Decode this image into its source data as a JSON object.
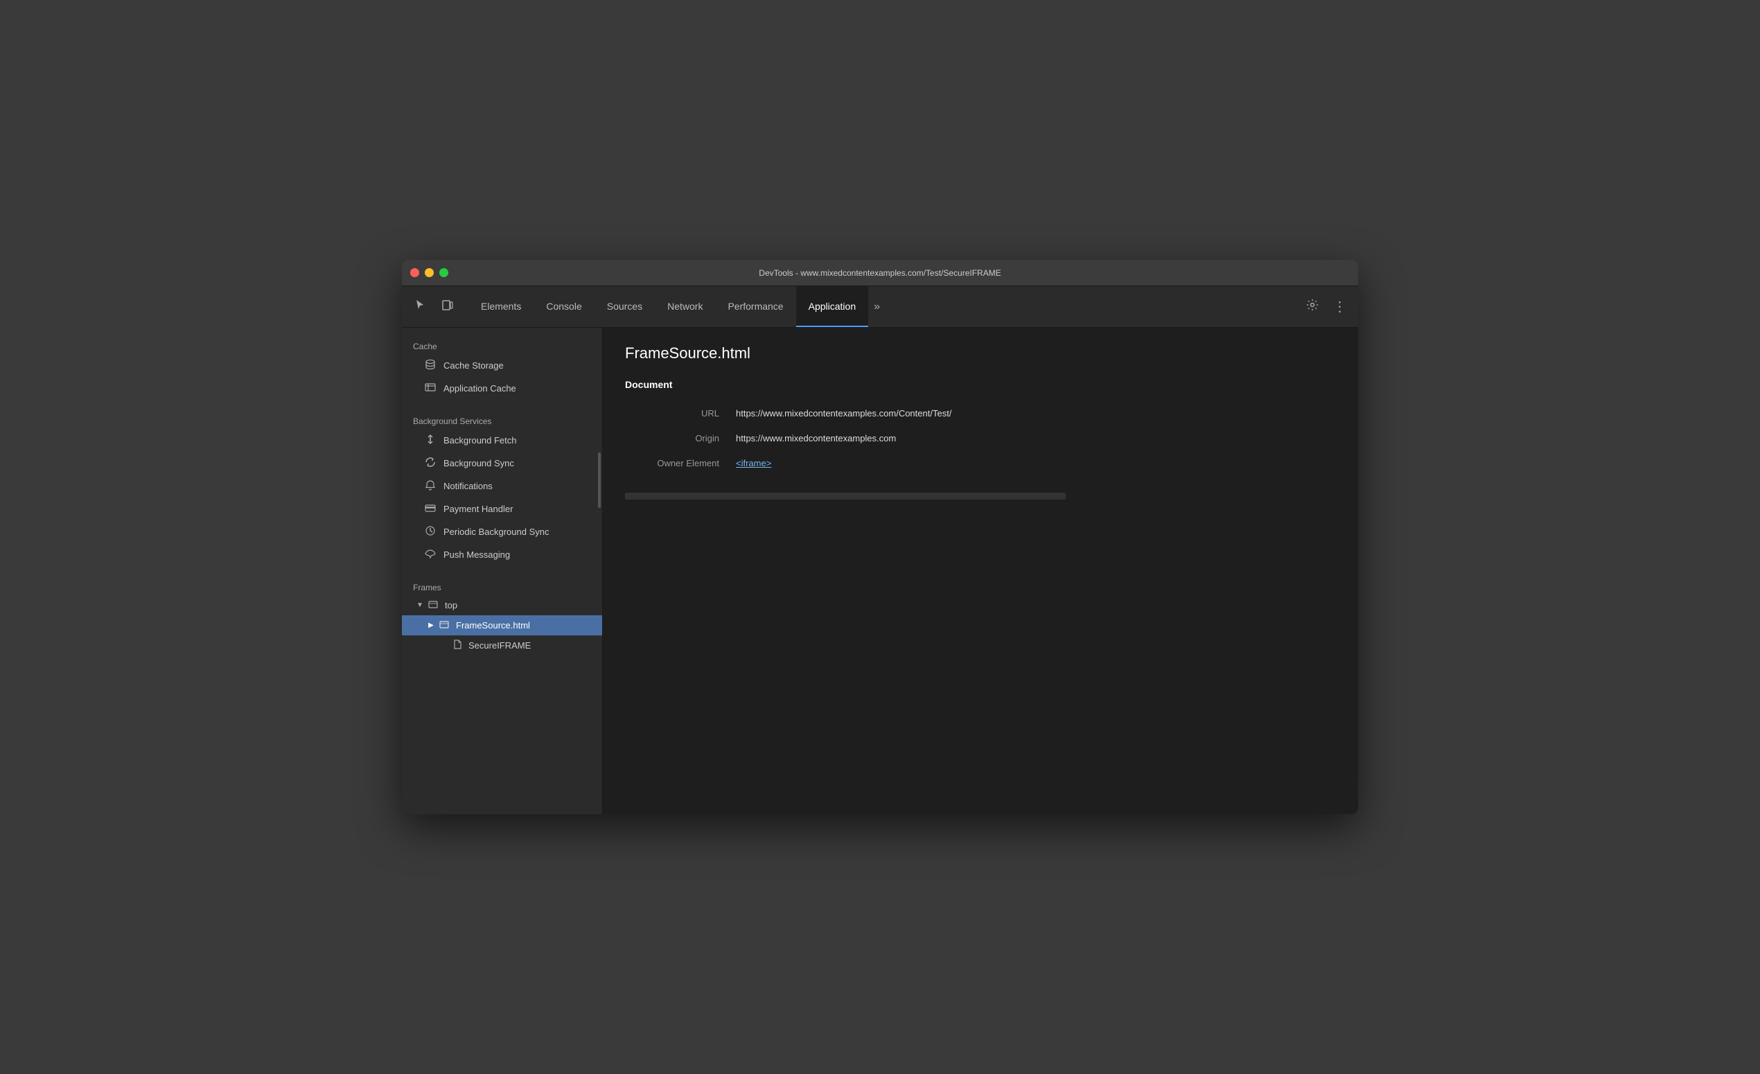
{
  "window": {
    "title": "DevTools - www.mixedcontentexamples.com/Test/SecureIFRAME"
  },
  "toolbar": {
    "icons": [
      {
        "name": "cursor-icon",
        "symbol": "↖",
        "label": "Cursor"
      },
      {
        "name": "device-icon",
        "symbol": "⬛",
        "label": "Device"
      }
    ],
    "tabs": [
      {
        "id": "elements",
        "label": "Elements",
        "active": false
      },
      {
        "id": "console",
        "label": "Console",
        "active": false
      },
      {
        "id": "sources",
        "label": "Sources",
        "active": false
      },
      {
        "id": "network",
        "label": "Network",
        "active": false
      },
      {
        "id": "performance",
        "label": "Performance",
        "active": false
      },
      {
        "id": "application",
        "label": "Application",
        "active": true
      }
    ],
    "overflow_label": "»",
    "settings_label": "⚙",
    "more_label": "⋮"
  },
  "sidebar": {
    "sections": [
      {
        "id": "cache",
        "label": "Cache",
        "items": [
          {
            "id": "cache-storage",
            "label": "Cache Storage",
            "icon": "🗄"
          },
          {
            "id": "application-cache",
            "label": "Application Cache",
            "icon": "⊞"
          }
        ]
      },
      {
        "id": "background-services",
        "label": "Background Services",
        "items": [
          {
            "id": "background-fetch",
            "label": "Background Fetch",
            "icon": "↕"
          },
          {
            "id": "background-sync",
            "label": "Background Sync",
            "icon": "↺"
          },
          {
            "id": "notifications",
            "label": "Notifications",
            "icon": "🔔"
          },
          {
            "id": "payment-handler",
            "label": "Payment Handler",
            "icon": "▬"
          },
          {
            "id": "periodic-background-sync",
            "label": "Periodic Background Sync",
            "icon": "⏱"
          },
          {
            "id": "push-messaging",
            "label": "Push Messaging",
            "icon": "☁"
          }
        ]
      },
      {
        "id": "frames",
        "label": "Frames"
      }
    ],
    "frames_tree": [
      {
        "id": "top",
        "label": "top",
        "level": 0,
        "expanded": true,
        "type": "folder"
      },
      {
        "id": "framesource-html",
        "label": "FrameSource.html",
        "level": 1,
        "expanded": false,
        "type": "folder",
        "selected": true
      },
      {
        "id": "secureiframe",
        "label": "SecureIFRAME",
        "level": 2,
        "expanded": false,
        "type": "file"
      }
    ]
  },
  "panel": {
    "title": "FrameSource.html",
    "section_label": "Document",
    "fields": [
      {
        "id": "url",
        "label": "URL",
        "value": "https://www.mixedcontentexamples.com/Content/Test/",
        "type": "text"
      },
      {
        "id": "origin",
        "label": "Origin",
        "value": "https://www.mixedcontentexamples.com",
        "type": "text"
      },
      {
        "id": "owner-element",
        "label": "Owner Element",
        "value": "<iframe>",
        "type": "link"
      }
    ]
  }
}
